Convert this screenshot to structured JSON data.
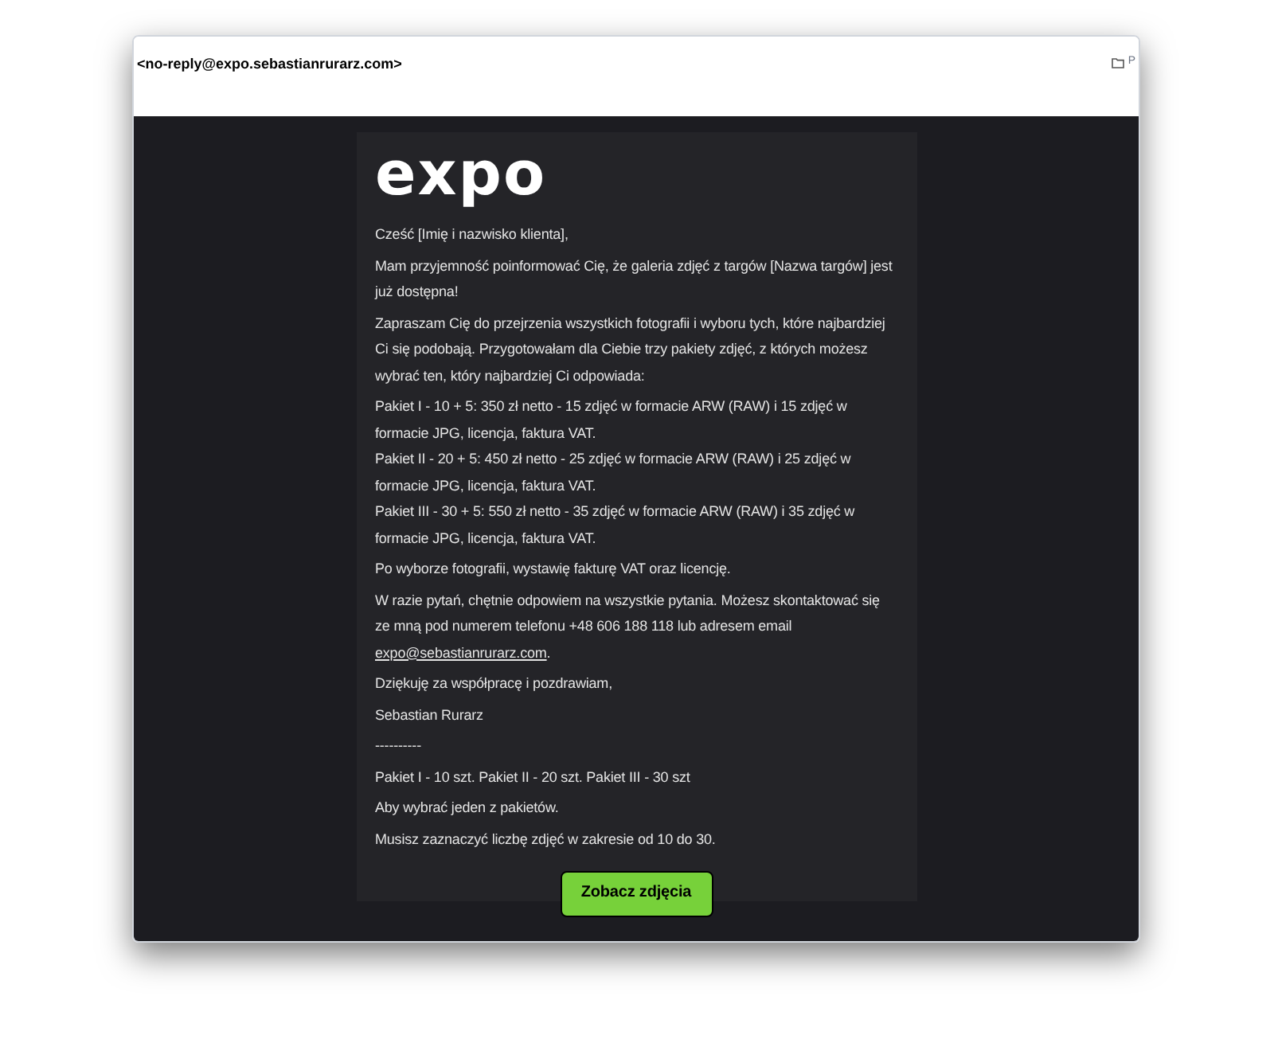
{
  "header": {
    "sender": "<no-reply@expo.sebastianrurarz.com>",
    "folder": "P"
  },
  "email": {
    "logo": "expo",
    "greeting": "Cześć [Imię i nazwisko klienta],",
    "paragraphs_before": [
      "Mam przyjemność poinformować Cię, że galeria zdjęć z targów [Nazwa targów] jest już dostępna!",
      "Zapraszam Cię do przejrzenia wszystkich fotografii i wyboru tych, które najbardziej Ci się podobają. Przygotowałam dla Ciebie trzy pakiety zdjęć, z których możesz wybrać ten, który najbardziej Ci odpowiada:"
    ],
    "packages": [
      "Pakiet I - 10 + 5: 350 zł netto - 15 zdjęć w formacie ARW (RAW) i 15 zdjęć w formacie JPG, licencja, faktura VAT.",
      "Pakiet II - 20 + 5: 450 zł netto - 25 zdjęć w formacie ARW (RAW) i 25 zdjęć w formacie JPG, licencja, faktura VAT.",
      "Pakiet III - 30 + 5: 550 zł netto - 35 zdjęć w formacie ARW (RAW) i 35 zdjęć w formacie JPG, licencja, faktura VAT."
    ],
    "invoice_note": "Po wyborze fotografii, wystawię fakturę VAT oraz licencję.",
    "contact": {
      "text": "W razie pytań, chętnie odpowiem na wszystkie pytania. Możesz skontaktować się ze mną pod numerem telefonu +48 606 188 118 lub adresem email",
      "link": "expo@sebastianrurarz.com",
      "after": "."
    },
    "paragraphs_after": [
      "Dziękuję za współpracę i pozdrawiam,",
      "Sebastian Rurarz",
      "----------",
      "Pakiet I - 10 szt. Pakiet II - 20 szt. Pakiet III - 30 szt",
      "Aby wybrać jeden z pakietów.",
      "Musisz zaznaczyć liczbę zdjęć w zakresie od 10 do 30."
    ],
    "button": "Zobacz zdjęcia"
  }
}
